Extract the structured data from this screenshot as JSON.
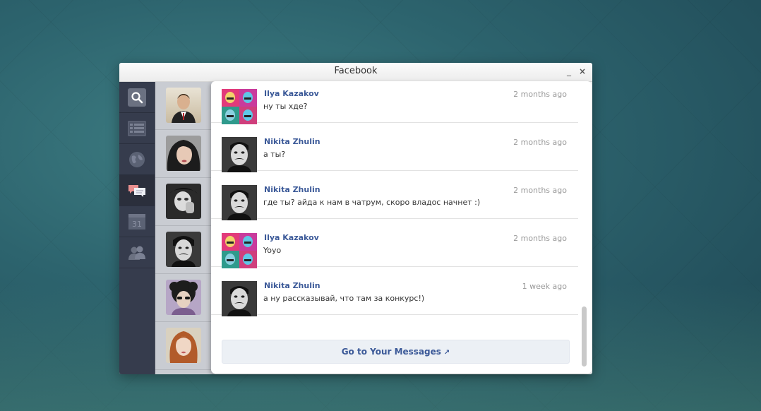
{
  "window": {
    "title": "Facebook",
    "minimize": "_",
    "close": "×"
  },
  "sidebar": {
    "items": [
      {
        "icon": "search-icon"
      },
      {
        "icon": "news-feed-icon"
      },
      {
        "icon": "globe-icon"
      },
      {
        "icon": "messages-icon"
      },
      {
        "icon": "calendar-icon",
        "label": "31"
      },
      {
        "icon": "friends-icon"
      }
    ]
  },
  "messages": [
    {
      "name": "Ilya Kazakov",
      "time": "2 months ago",
      "text": "ну ты хде?"
    },
    {
      "name": "Nikita Zhulin",
      "time": "2 months ago",
      "text": "а ты?"
    },
    {
      "name": "Nikita Zhulin",
      "time": "2 months ago",
      "text": "где ты? айда к нам в чатрум, скоро владос начнет :)"
    },
    {
      "name": "Ilya Kazakov",
      "time": "2 months ago",
      "text": "Yoyo"
    },
    {
      "name": "Nikita Zhulin",
      "time": "1 week ago",
      "text": "а ну рассказывай, что там за конкурс!)"
    }
  ],
  "goto_label": "Go to Your Messages",
  "colors": {
    "link": "#3b5998",
    "sidebar": "#363c4d",
    "popup": "#ffffff"
  }
}
